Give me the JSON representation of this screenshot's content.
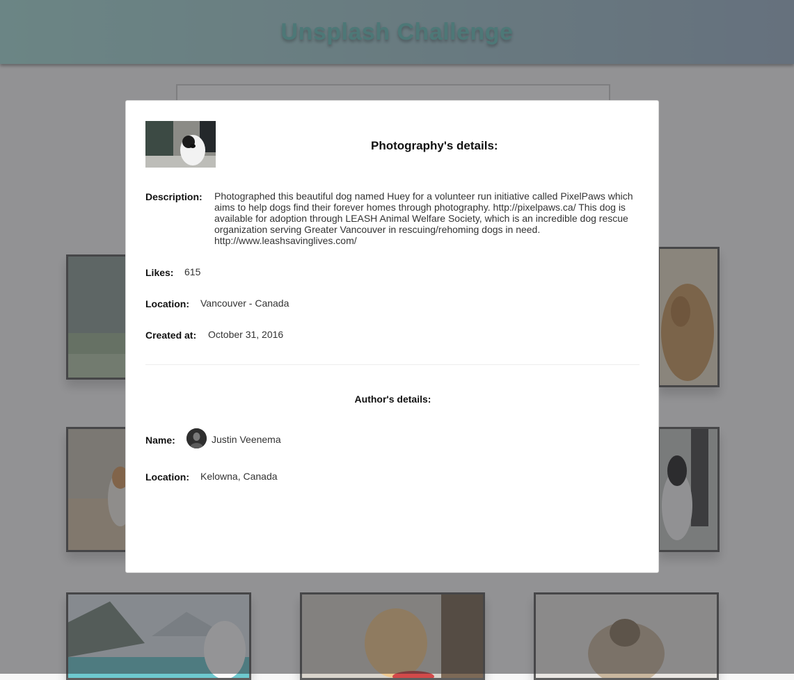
{
  "header": {
    "title": "Unsplash Challenge"
  },
  "modal": {
    "photo_section_title": "Photography's details:",
    "description_label": "Description:",
    "description": "Photographed this beautiful dog named Huey for a volunteer run initiative called PixelPaws which aims to help dogs find their forever homes through photography. http://pixelpaws.ca/ This dog is available for adoption through LEASH Animal Welfare Society, which is an incredible dog rescue organization serving Greater Vancouver in rescuing/rehoming dogs in need. http://www.leashsavinglives.com/",
    "likes_label": "Likes:",
    "likes": "615",
    "location_label": "Location:",
    "location": "Vancouver - Canada",
    "created_label": "Created at:",
    "created": "October 31, 2016",
    "author_section_title": "Author's details:",
    "author_name_label": "Name:",
    "author_name": "Justin Veenema",
    "author_location_label": "Location:",
    "author_location": "Kelowna, Canada"
  }
}
